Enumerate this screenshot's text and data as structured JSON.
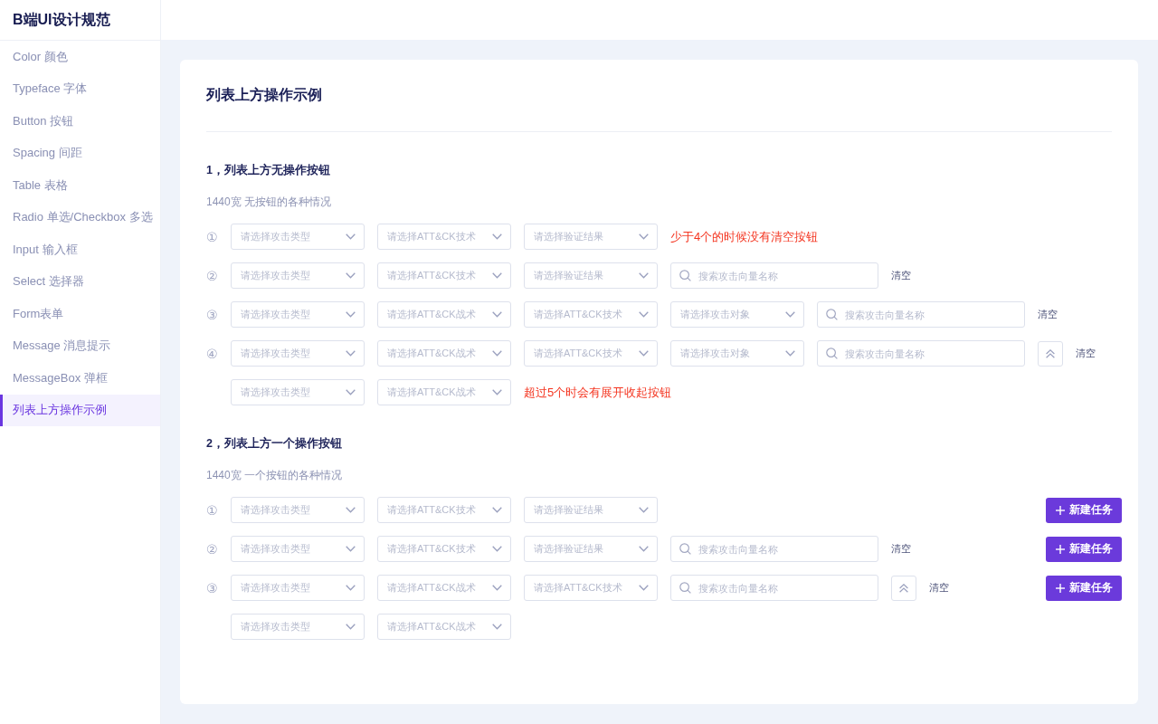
{
  "sidebar": {
    "title": "B端UI设计规范",
    "items": [
      {
        "label": "Color 颜色",
        "selected": false
      },
      {
        "label": "Typeface 字体",
        "selected": false
      },
      {
        "label": "Button 按钮",
        "selected": false
      },
      {
        "label": "Spacing 间距",
        "selected": false
      },
      {
        "label": "Table 表格",
        "selected": false
      },
      {
        "label": "Radio 单选/Checkbox 多选",
        "selected": false
      },
      {
        "label": "Input 输入框",
        "selected": false
      },
      {
        "label": "Select 选择器",
        "selected": false
      },
      {
        "label": "Form表单",
        "selected": false
      },
      {
        "label": "Message 消息提示",
        "selected": false
      },
      {
        "label": "MessageBox 弹框",
        "selected": false
      },
      {
        "label": "列表上方操作示例",
        "selected": true
      }
    ]
  },
  "page": {
    "title": "列表上方操作示例",
    "sections": [
      {
        "heading": "1，列表上方无操作按钮",
        "subtitle": "1440宽 无按钮的各种情况",
        "rows": [
          {
            "index": "①",
            "controls": [
              {
                "kind": "select",
                "placeholder": "请选择攻击类型"
              },
              {
                "kind": "select",
                "placeholder": "请选择ATT&CK技术"
              },
              {
                "kind": "select",
                "placeholder": "请选择验证结果"
              },
              {
                "kind": "note",
                "text": "少于4个的时候没有清空按钮"
              }
            ]
          },
          {
            "index": "②",
            "controls": [
              {
                "kind": "select",
                "placeholder": "请选择攻击类型"
              },
              {
                "kind": "select",
                "placeholder": "请选择ATT&CK技术"
              },
              {
                "kind": "select",
                "placeholder": "请选择验证结果"
              },
              {
                "kind": "search",
                "placeholder": "搜索攻击向量名称"
              },
              {
                "kind": "clear",
                "label": "清空"
              }
            ]
          },
          {
            "index": "③",
            "controls": [
              {
                "kind": "select",
                "placeholder": "请选择攻击类型"
              },
              {
                "kind": "select",
                "placeholder": "请选择ATT&CK战术"
              },
              {
                "kind": "select",
                "placeholder": "请选择ATT&CK技术"
              },
              {
                "kind": "select",
                "placeholder": "请选择攻击对象"
              },
              {
                "kind": "search",
                "placeholder": "搜索攻击向量名称"
              },
              {
                "kind": "clear",
                "label": "清空"
              }
            ]
          },
          {
            "index": "④",
            "controls": [
              {
                "kind": "select",
                "placeholder": "请选择攻击类型"
              },
              {
                "kind": "select",
                "placeholder": "请选择ATT&CK战术"
              },
              {
                "kind": "select",
                "placeholder": "请选择ATT&CK技术"
              },
              {
                "kind": "select",
                "placeholder": "请选择攻击对象"
              },
              {
                "kind": "search",
                "placeholder": "搜索攻击向量名称"
              },
              {
                "kind": "expand",
                "expanded": true
              },
              {
                "kind": "clear",
                "label": "清空"
              }
            ]
          },
          {
            "controls": [
              {
                "kind": "select",
                "placeholder": "请选择攻击类型"
              },
              {
                "kind": "select",
                "placeholder": "请选择ATT&CK战术"
              },
              {
                "kind": "note",
                "text": "超过5个时会有展开收起按钮"
              }
            ]
          }
        ]
      },
      {
        "heading": "2，列表上方一个操作按钮",
        "subtitle": "1440宽 一个按钮的各种情况",
        "rows": [
          {
            "index": "①",
            "controls": [
              {
                "kind": "select",
                "placeholder": "请选择攻击类型"
              },
              {
                "kind": "select",
                "placeholder": "请选择ATT&CK技术"
              },
              {
                "kind": "select",
                "placeholder": "请选择验证结果"
              }
            ],
            "action": {
              "label": "新建任务"
            }
          },
          {
            "index": "②",
            "controls": [
              {
                "kind": "select",
                "placeholder": "请选择攻击类型"
              },
              {
                "kind": "select",
                "placeholder": "请选择ATT&CK技术"
              },
              {
                "kind": "select",
                "placeholder": "请选择验证结果"
              },
              {
                "kind": "search",
                "placeholder": "搜索攻击向量名称"
              },
              {
                "kind": "clear",
                "label": "清空"
              }
            ],
            "action": {
              "label": "新建任务"
            }
          },
          {
            "index": "③",
            "controls": [
              {
                "kind": "select",
                "placeholder": "请选择攻击类型"
              },
              {
                "kind": "select",
                "placeholder": "请选择ATT&CK战术"
              },
              {
                "kind": "select",
                "placeholder": "请选择ATT&CK技术"
              },
              {
                "kind": "search",
                "placeholder": "搜索攻击向量名称"
              },
              {
                "kind": "expand",
                "expanded": true
              },
              {
                "kind": "clear",
                "label": "清空"
              }
            ],
            "action": {
              "label": "新建任务"
            }
          },
          {
            "controls": [
              {
                "kind": "select",
                "placeholder": "请选择攻击类型"
              },
              {
                "kind": "select",
                "placeholder": "请选择ATT&CK战术"
              }
            ]
          }
        ]
      }
    ]
  }
}
